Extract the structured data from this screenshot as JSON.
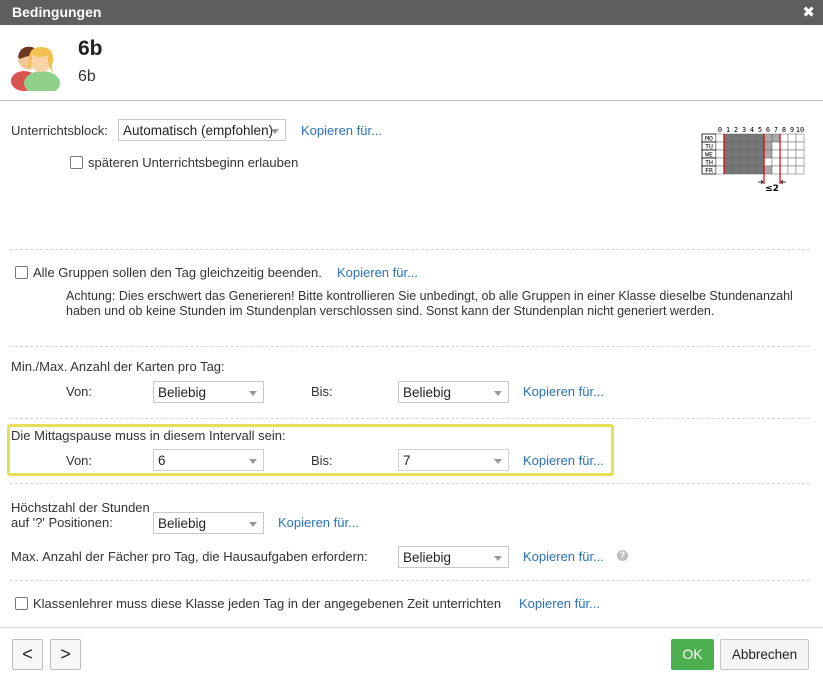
{
  "window": {
    "title": "Bedingungen"
  },
  "header": {
    "title": "6b",
    "subtitle": "6b"
  },
  "block": {
    "label": "Unterrichtsblock:",
    "value": "Automatisch (empfohlen)",
    "copy": "Kopieren für...",
    "later_start": "späteren Unterrichtsbeginn erlauben"
  },
  "diagram": {
    "columns": [
      "0",
      "1",
      "2",
      "3",
      "4",
      "5",
      "6",
      "7",
      "8",
      "9",
      "10"
    ],
    "rows": [
      "MO",
      "TU",
      "WE",
      "TH",
      "FR"
    ],
    "limit_label": "≤2"
  },
  "groups": {
    "label": "Alle Gruppen sollen den Tag gleichzeitig beenden.",
    "copy": "Kopieren für...",
    "note": "Achtung: Dies erschwert das Generieren! Bitte kontrollieren Sie unbedingt, ob alle Gruppen in einer Klasse dieselbe Stundenanzahl haben und ob keine Stunden im Stundenplan verschlossen sind. Sonst kann der Stundenplan nicht generiert werden."
  },
  "cards": {
    "label": "Min./Max. Anzahl der Karten pro Tag:",
    "from_label": "Von:",
    "from_value": "Beliebig",
    "to_label": "Bis:",
    "to_value": "Beliebig",
    "copy": "Kopieren für..."
  },
  "lunch": {
    "label": "Die Mittagspause muss in diesem Intervall sein:",
    "from_label": "Von:",
    "from_value": "6",
    "to_label": "Bis:",
    "to_value": "7",
    "copy": "Kopieren für..."
  },
  "max_hours": {
    "label_line1": "Höchstzahl der Stunden",
    "label_line2": "auf '?' Positionen:",
    "value": "Beliebig",
    "copy": "Kopieren für..."
  },
  "homework": {
    "label": "Max. Anzahl der Fächer pro Tag, die  Hausaufgaben erfordern:",
    "value": "Beliebig",
    "copy": "Kopieren für...",
    "help": "?"
  },
  "teacher": {
    "label": "Klassenlehrer muss diese Klasse jeden Tag in der angegebenen Zeit unterrichten",
    "copy": "Kopieren für..."
  },
  "footer": {
    "prev": "<",
    "next": ">",
    "ok": "OK",
    "cancel": "Abbrechen"
  }
}
